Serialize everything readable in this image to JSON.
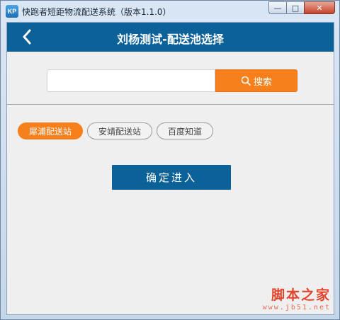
{
  "window": {
    "title": "快跑者短距物流配送系统（版本1.1.0）",
    "app_icon_text": "KP",
    "controls": {
      "minimize": "—",
      "maximize": "□",
      "close": "✕"
    }
  },
  "header": {
    "title": "刘杨测试-配送池选择",
    "back_icon": "chevron-left-icon"
  },
  "search": {
    "value": "",
    "placeholder": "",
    "button_label": "搜索",
    "button_icon": "search-icon"
  },
  "stations": [
    {
      "label": "犀浦配送站",
      "selected": true
    },
    {
      "label": "安靖配送站",
      "selected": false
    },
    {
      "label": "百度知道",
      "selected": false
    }
  ],
  "enter_button_label": "确定进入",
  "watermark": {
    "text": "脚本之家",
    "url": "www.jb51.net"
  },
  "colors": {
    "header_blue": "#0d6199",
    "accent_orange": "#f77f1c",
    "background": "#efefef"
  }
}
